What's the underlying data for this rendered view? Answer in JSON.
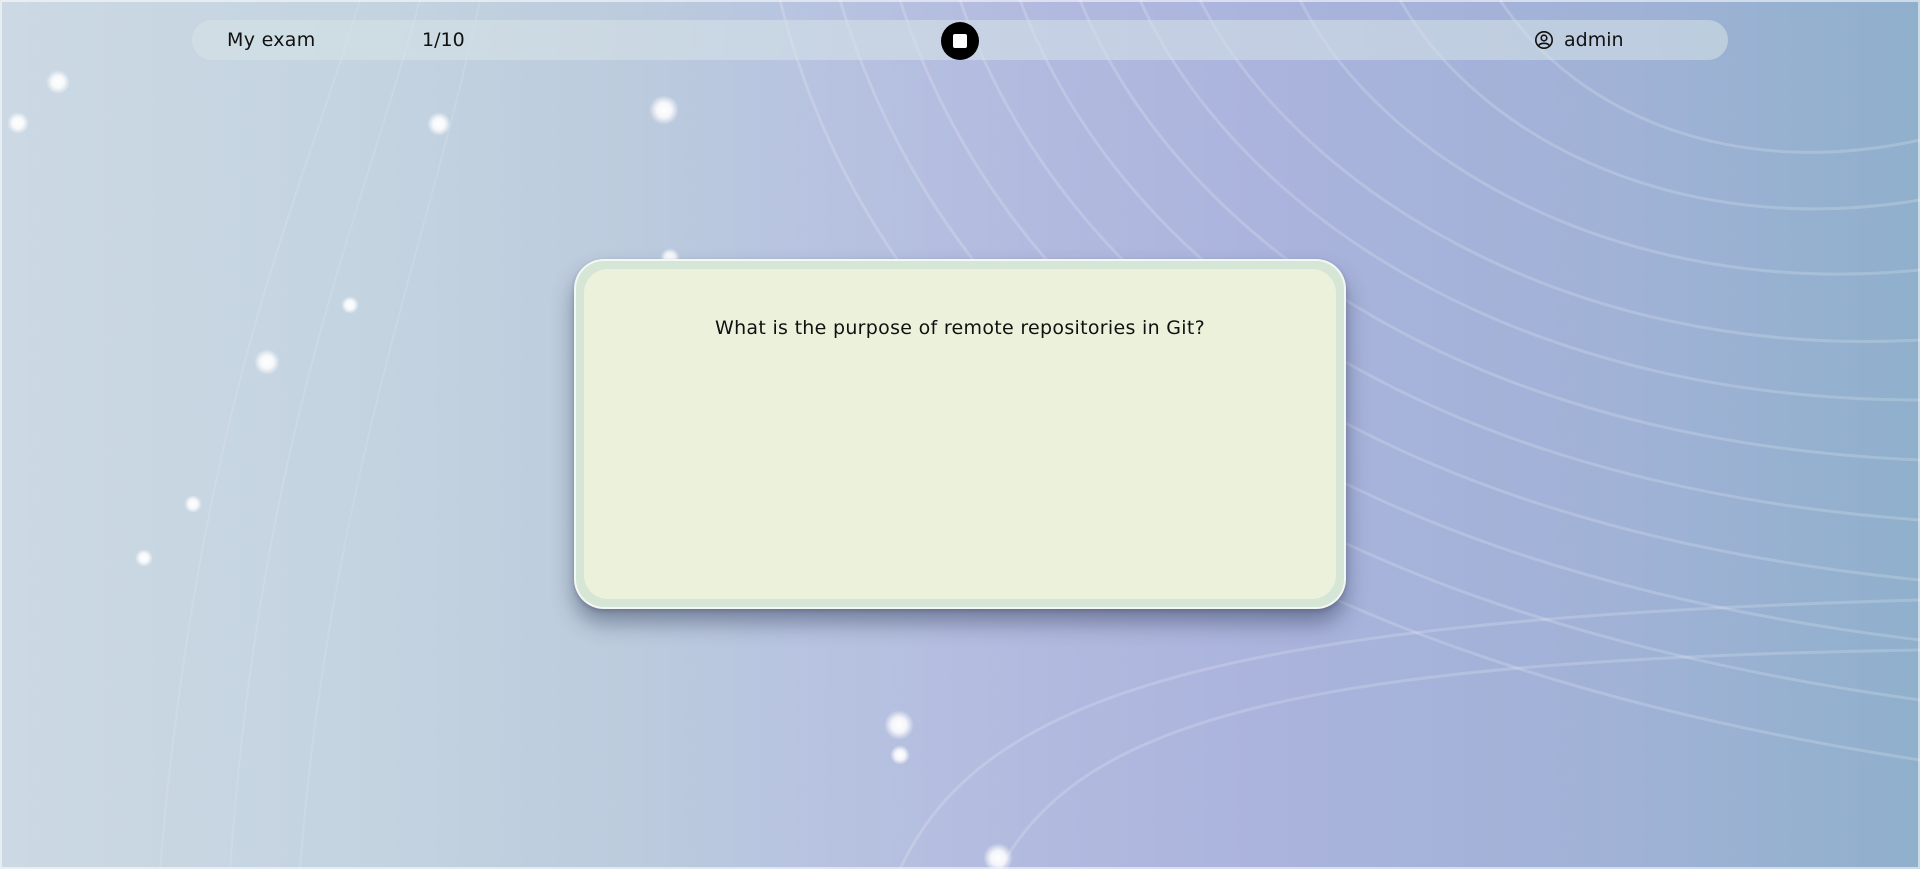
{
  "header": {
    "exam_title": "My exam",
    "progress": "1/10",
    "stop_icon": "stop-icon",
    "user_icon": "user-circle-icon",
    "username": "admin"
  },
  "question": {
    "text": "What is the purpose of remote repositories in Git?"
  },
  "colors": {
    "card_fill": "#ecf1db",
    "card_border": "#d6e6d6",
    "stop_button": "#000000"
  }
}
